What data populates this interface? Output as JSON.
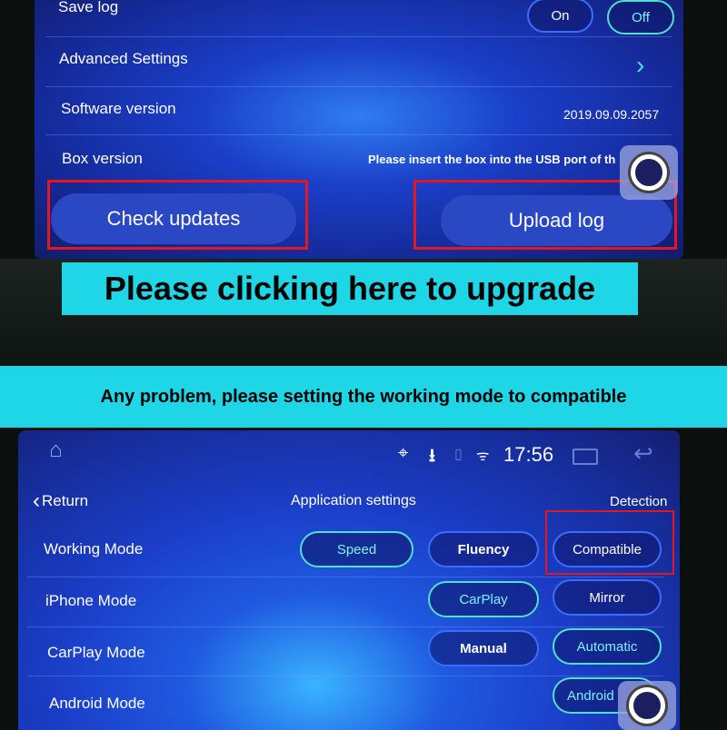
{
  "top_screen": {
    "save_log": {
      "label": "Save log",
      "on": "On",
      "off": "Off"
    },
    "advanced_settings": {
      "label": "Advanced Settings",
      "chevron": "chevron-right-icon"
    },
    "software_version": {
      "label": "Software version",
      "value": "2019.09.09.2057"
    },
    "box_version": {
      "label": "Box version",
      "value": "Please insert the box into the USB port of th"
    },
    "check_updates": "Check updates",
    "upload_log": "Upload log"
  },
  "annotations": {
    "upgrade_banner": "Please clicking here to upgrade",
    "mode_banner": "Any problem, please setting the working mode to compatible",
    "highlight_color": "#e5161e",
    "banner_color": "#1ed6e6"
  },
  "status_bar": {
    "time": "17:56",
    "icons": [
      "home-icon",
      "location-icon",
      "download-icon",
      "bluetooth-icon",
      "wifi-icon",
      "recent-apps-icon",
      "back-icon"
    ]
  },
  "app_settings": {
    "return": "Return",
    "title": "Application settings",
    "detection": "Detection",
    "rows": [
      {
        "label": "Working Mode",
        "options": [
          "Speed",
          "Fluency",
          "Compatible"
        ],
        "selected": "Speed"
      },
      {
        "label": "iPhone Mode",
        "options": [
          "CarPlay",
          "Mirror"
        ],
        "selected": "CarPlay"
      },
      {
        "label": "CarPlay Mode",
        "options": [
          "Manual",
          "Automatic"
        ],
        "selected": "Automatic"
      },
      {
        "label": "Android Mode",
        "options": [
          "Android"
        ],
        "selected": "Android"
      }
    ]
  }
}
